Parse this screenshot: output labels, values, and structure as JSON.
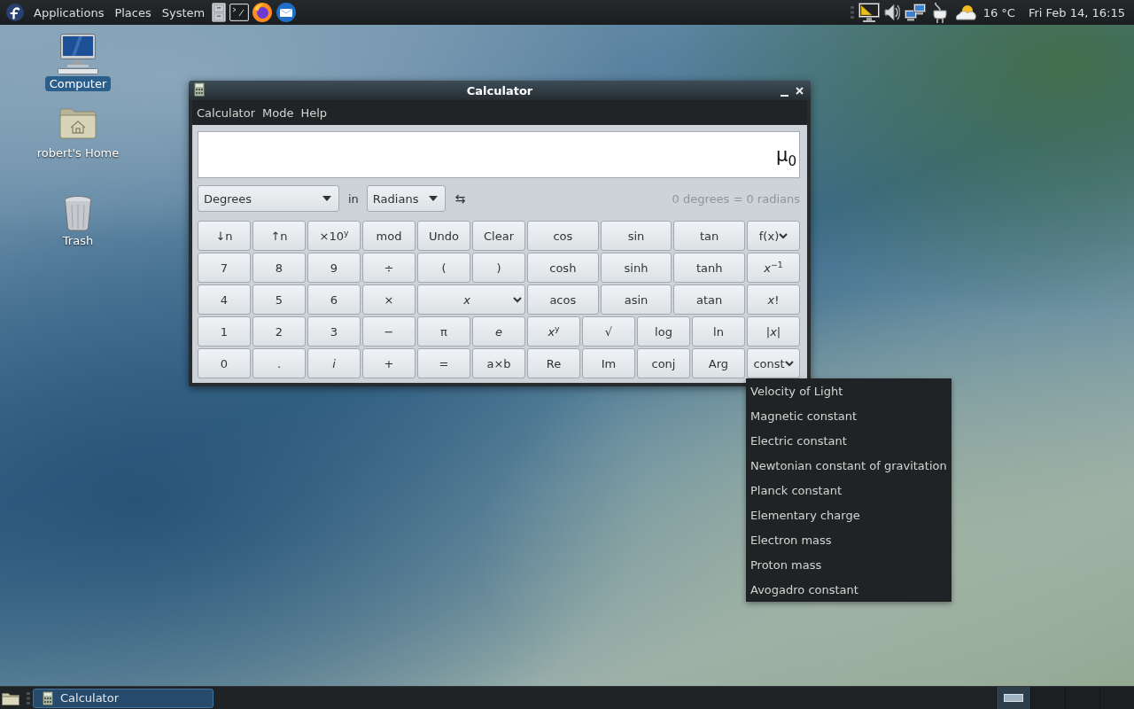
{
  "top_panel": {
    "menus": [
      "Applications",
      "Places",
      "System"
    ],
    "temperature": "16 °C",
    "clock": "Fri Feb 14, 16:15"
  },
  "desktop_icons": [
    {
      "kind": "computer",
      "label": "Computer",
      "selected": true
    },
    {
      "kind": "home",
      "label": "robert's Home",
      "selected": false
    },
    {
      "kind": "trash",
      "label": "Trash",
      "selected": false
    }
  ],
  "window": {
    "title": "Calculator",
    "menus": [
      "Calculator",
      "Mode",
      "Help"
    ],
    "display": "μ$_{0}$",
    "converter": {
      "from": "Degrees",
      "in_label": "in",
      "to": "Radians",
      "swap": "⇆",
      "result": "0 degrees = 0 radians"
    },
    "keypad": [
      [
        {
          "kind": "key",
          "label": "↓n"
        },
        {
          "kind": "key",
          "label": "↑n"
        },
        {
          "kind": "key",
          "label": "×10$^{y}$"
        },
        {
          "kind": "key",
          "label": "mod"
        },
        {
          "kind": "key",
          "label": "Undo"
        },
        {
          "kind": "key",
          "label": "Clear"
        },
        {
          "kind": "key",
          "label": "cos"
        },
        {
          "kind": "key",
          "label": "sin"
        },
        {
          "kind": "key",
          "label": "tan"
        },
        {
          "kind": "menu",
          "label": "f(x)"
        }
      ],
      [
        {
          "kind": "key",
          "label": "7"
        },
        {
          "kind": "key",
          "label": "8"
        },
        {
          "kind": "key",
          "label": "9"
        },
        {
          "kind": "key",
          "label": "÷"
        },
        {
          "kind": "key",
          "label": "("
        },
        {
          "kind": "key",
          "label": ")"
        },
        {
          "kind": "key",
          "label": "cosh"
        },
        {
          "kind": "key",
          "label": "sinh"
        },
        {
          "kind": "key",
          "label": "tanh"
        },
        {
          "kind": "key",
          "label": "*x*$^{−1}$"
        }
      ],
      [
        {
          "kind": "key",
          "label": "4"
        },
        {
          "kind": "key",
          "label": "5"
        },
        {
          "kind": "key",
          "label": "6"
        },
        {
          "kind": "key",
          "label": "×"
        },
        {
          "kind": "menu",
          "label": "*x*"
        },
        {
          "kind": "key",
          "label": "acos"
        },
        {
          "kind": "key",
          "label": "asin"
        },
        {
          "kind": "key",
          "label": "atan"
        },
        {
          "kind": "key",
          "label": "*x*!"
        }
      ],
      [
        {
          "kind": "key",
          "label": "1"
        },
        {
          "kind": "key",
          "label": "2"
        },
        {
          "kind": "key",
          "label": "3"
        },
        {
          "kind": "key",
          "label": "−"
        },
        {
          "kind": "key",
          "label": "π"
        },
        {
          "kind": "key",
          "label": "*e*"
        },
        {
          "kind": "key",
          "label": "*x*$^{y}$"
        },
        {
          "kind": "key",
          "label": "√"
        },
        {
          "kind": "key",
          "label": "log"
        },
        {
          "kind": "key",
          "label": "ln"
        },
        {
          "kind": "key",
          "label": "|*x*|"
        }
      ],
      [
        {
          "kind": "key",
          "label": "0"
        },
        {
          "kind": "key",
          "label": "."
        },
        {
          "kind": "key",
          "label": "*i*"
        },
        {
          "kind": "key",
          "label": "+"
        },
        {
          "kind": "key",
          "label": "="
        },
        {
          "kind": "key",
          "label": "a×b"
        },
        {
          "kind": "key",
          "label": "Re"
        },
        {
          "kind": "key",
          "label": "Im"
        },
        {
          "kind": "key",
          "label": "conj"
        },
        {
          "kind": "key",
          "label": "Arg"
        },
        {
          "kind": "menu",
          "label": "const",
          "options": [
            "Velocity of Light",
            "Magnetic constant",
            "Electric constant",
            "Newtonian constant of gravitation",
            "Planck constant",
            "Elementary charge",
            "Electron mass",
            "Proton mass",
            "Avogadro constant"
          ]
        }
      ]
    ]
  },
  "taskbar": {
    "tasks": [
      {
        "label": "Calculator",
        "selected": true
      }
    ],
    "workspaces": [
      {
        "selected": true
      },
      {
        "selected": false
      },
      {
        "selected": false
      },
      {
        "selected": false
      }
    ]
  }
}
